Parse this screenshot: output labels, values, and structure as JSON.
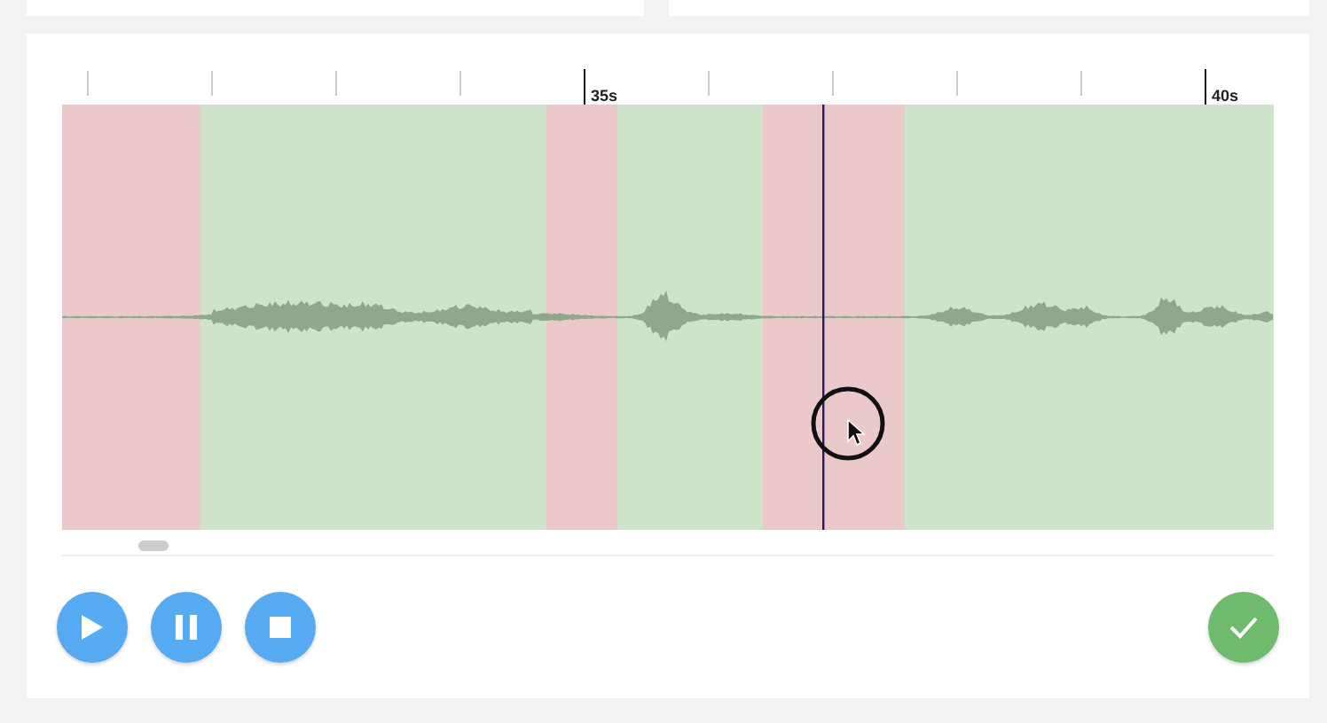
{
  "ruler": {
    "ticks": [
      {
        "major": false
      },
      {
        "major": false
      },
      {
        "major": false
      },
      {
        "major": false
      },
      {
        "major": true,
        "label": "35s"
      },
      {
        "major": false
      },
      {
        "major": false
      },
      {
        "major": false
      },
      {
        "major": false
      },
      {
        "major": true,
        "label": "40s"
      }
    ]
  },
  "segments": [
    {
      "kind": "rejected"
    },
    {
      "kind": "accepted"
    },
    {
      "kind": "rejected"
    },
    {
      "kind": "accepted"
    },
    {
      "kind": "rejected"
    },
    {
      "kind": "accepted"
    }
  ],
  "controls": [
    {
      "kind": "play"
    },
    {
      "kind": "pause"
    },
    {
      "kind": "stop"
    }
  ],
  "confirm": {
    "kind": "check"
  }
}
